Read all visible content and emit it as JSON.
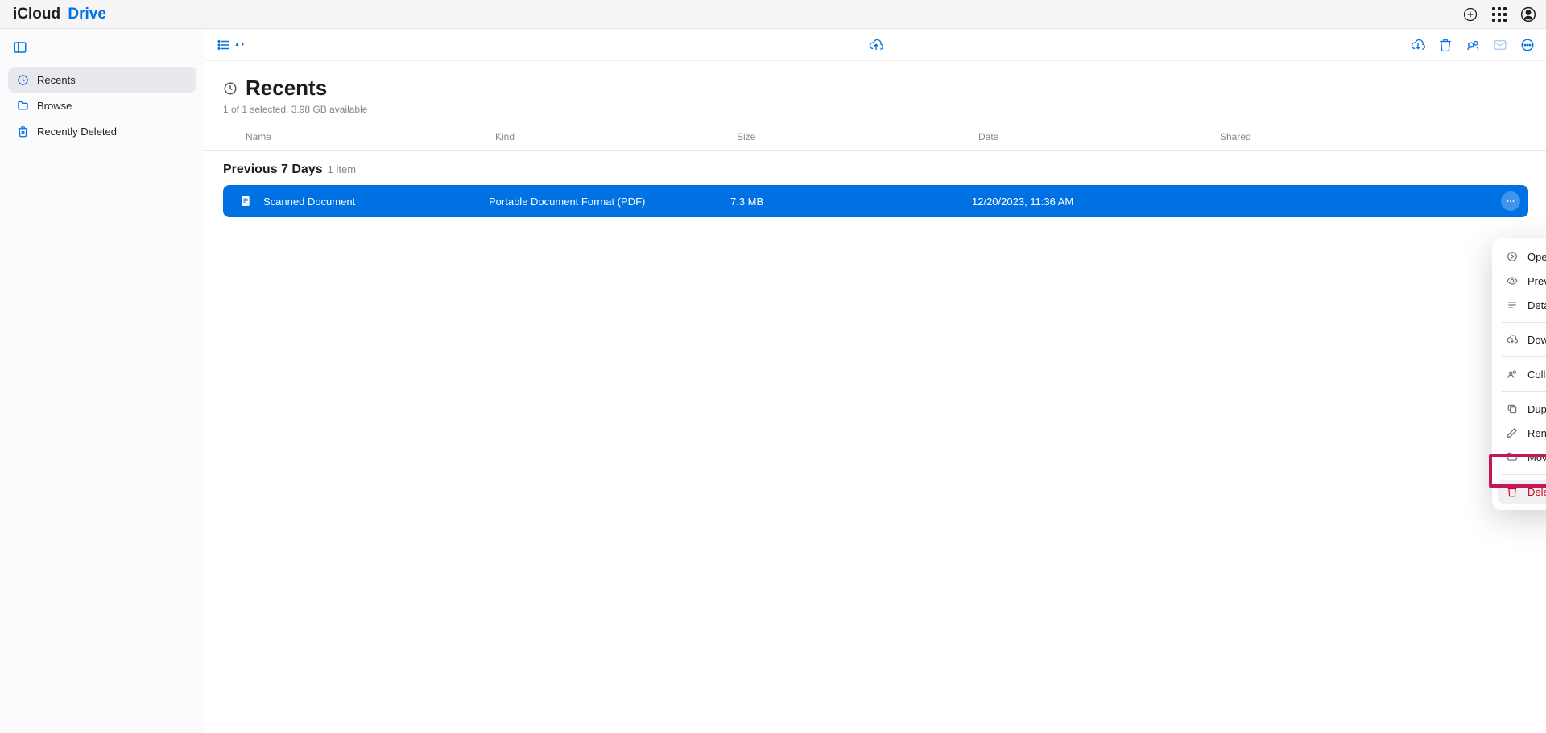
{
  "header": {
    "brand_icloud": "iCloud",
    "brand_drive": "Drive"
  },
  "sidebar": {
    "items": [
      {
        "label": "Recents"
      },
      {
        "label": "Browse"
      },
      {
        "label": "Recently Deleted"
      }
    ]
  },
  "page": {
    "title": "Recents",
    "subtitle": "1 of 1 selected, 3.98 GB available"
  },
  "columns": {
    "name": "Name",
    "kind": "Kind",
    "size": "Size",
    "date": "Date",
    "shared": "Shared"
  },
  "section": {
    "title": "Previous 7 Days",
    "count": "1 item"
  },
  "file": {
    "name": "Scanned Document",
    "kind": "Portable Document Format (PDF)",
    "size": "7.3 MB",
    "date": "12/20/2023, 11:36 AM"
  },
  "context_menu": {
    "open": "Open",
    "preview": "Preview",
    "details": "Details",
    "download": "Download a Copy…",
    "collaborate": "Collaborate with Others…",
    "duplicate": "Duplicate",
    "rename": "Rename",
    "move": "Move to Folder…",
    "delete": "Delete Selected"
  }
}
